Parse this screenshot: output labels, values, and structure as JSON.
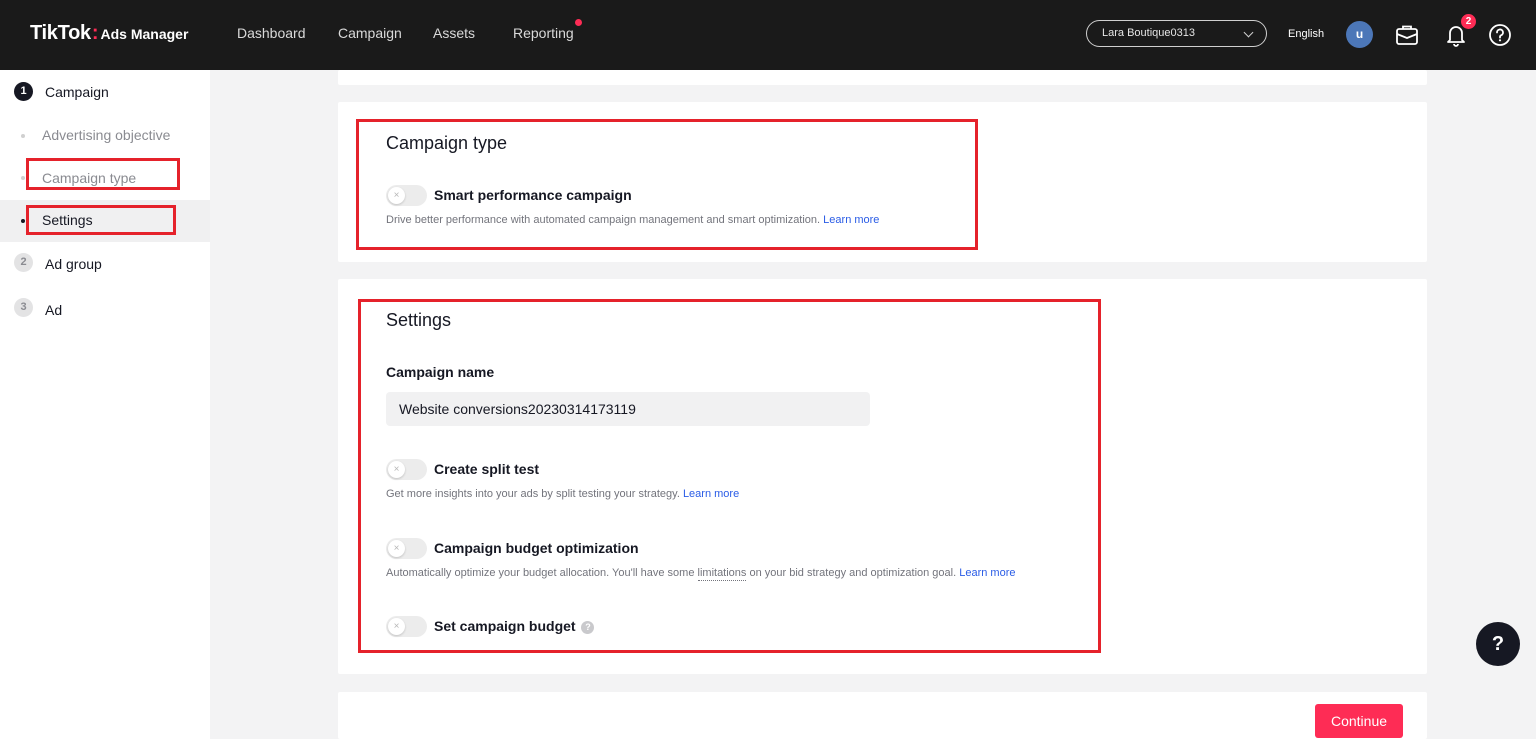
{
  "header": {
    "logo_main": "TikTok",
    "logo_sep": ":",
    "logo_sub": "Ads Manager",
    "nav": [
      "Dashboard",
      "Campaign",
      "Assets",
      "Reporting"
    ],
    "account_name": "Lara Boutique0313",
    "language": "English",
    "avatar_initial": "u",
    "notification_count": "2"
  },
  "sidebar": {
    "steps": [
      {
        "num": "1",
        "label": "Campaign"
      },
      {
        "num": "2",
        "label": "Ad group"
      },
      {
        "num": "3",
        "label": "Ad"
      }
    ],
    "substeps": [
      "Advertising objective",
      "Campaign type",
      "Settings"
    ]
  },
  "campaign_type": {
    "title": "Campaign type",
    "smart_label": "Smart performance campaign",
    "smart_desc": "Drive better performance with automated campaign management and smart optimization.",
    "learn_more": "Learn more"
  },
  "settings": {
    "title": "Settings",
    "campaign_name_label": "Campaign name",
    "campaign_name_value": "Website conversions20230314173119",
    "split_label": "Create split test",
    "split_desc": "Get more insights into your ads by split testing your strategy.",
    "cbo_label": "Campaign budget optimization",
    "cbo_desc_pre": "Automatically optimize your budget allocation. You'll have some",
    "cbo_desc_link": "limitations",
    "cbo_desc_post": "on your bid strategy and optimization goal.",
    "budget_label": "Set campaign budget",
    "learn_more": "Learn more",
    "toggle_off_glyph": "×"
  },
  "footer": {
    "continue_label": "Continue",
    "help_glyph": "?",
    "tooltip_glyph": "?"
  },
  "colors": {
    "accent": "#fe2c55",
    "highlight": "#e5222b",
    "link": "#2a5ce6"
  }
}
